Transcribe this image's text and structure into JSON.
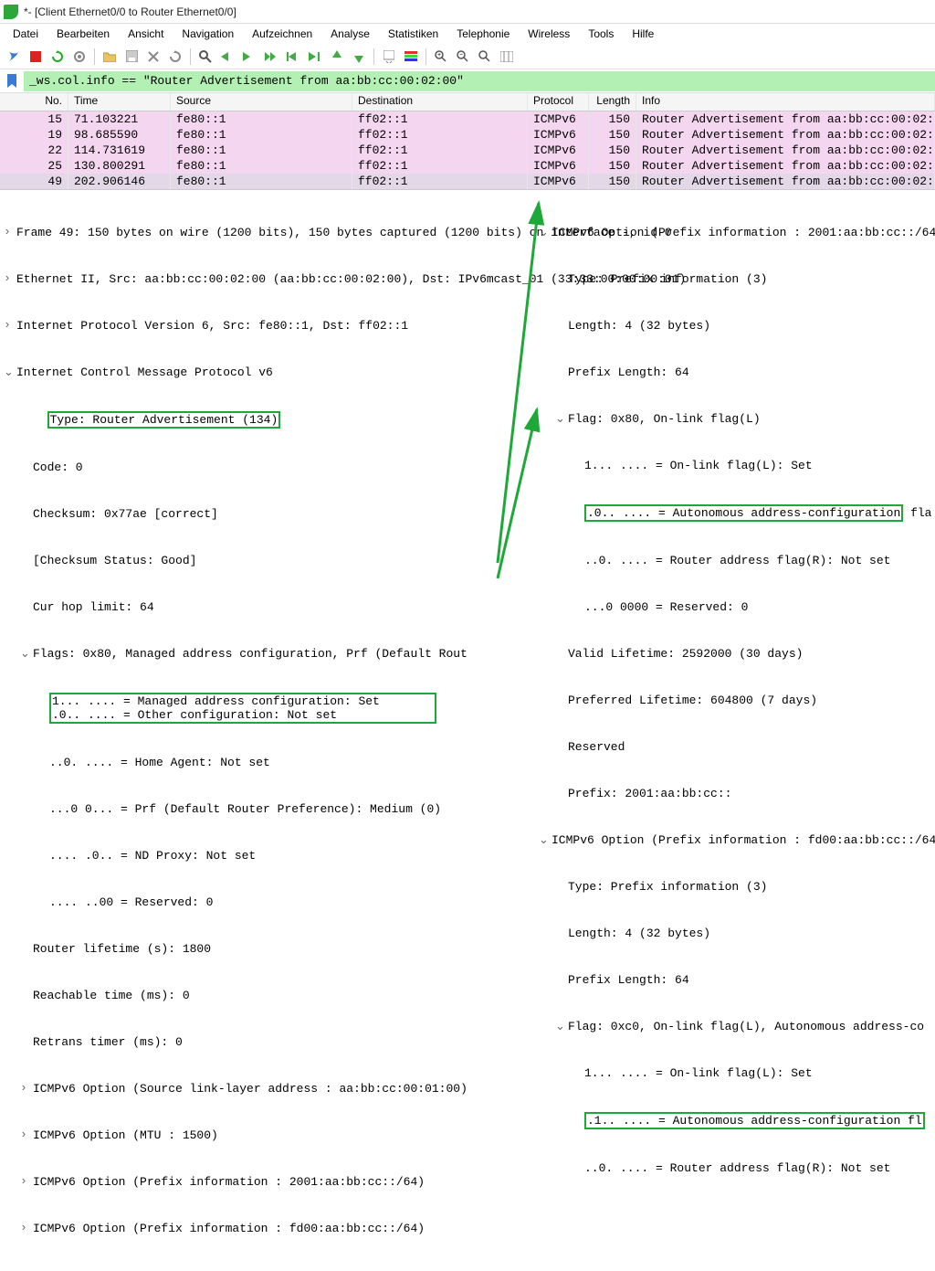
{
  "window": {
    "title": "*- [Client Ethernet0/0 to Router Ethernet0/0]"
  },
  "menu": [
    "Datei",
    "Bearbeiten",
    "Ansicht",
    "Navigation",
    "Aufzeichnen",
    "Analyse",
    "Statistiken",
    "Telephonie",
    "Wireless",
    "Tools",
    "Hilfe"
  ],
  "filter": {
    "value": "_ws.col.info == \"Router Advertisement from aa:bb:cc:00:02:00\""
  },
  "columns": [
    "No.",
    "Time",
    "Source",
    "Destination",
    "Protocol",
    "Length",
    "Info"
  ],
  "packets": [
    {
      "no": "15",
      "time": "71.103221",
      "src": "fe80::1",
      "dst": "ff02::1",
      "proto": "ICMPv6",
      "len": "150",
      "info": "Router Advertisement from aa:bb:cc:00:02:00",
      "sel": false
    },
    {
      "no": "19",
      "time": "98.685590",
      "src": "fe80::1",
      "dst": "ff02::1",
      "proto": "ICMPv6",
      "len": "150",
      "info": "Router Advertisement from aa:bb:cc:00:02:00",
      "sel": false
    },
    {
      "no": "22",
      "time": "114.731619",
      "src": "fe80::1",
      "dst": "ff02::1",
      "proto": "ICMPv6",
      "len": "150",
      "info": "Router Advertisement from aa:bb:cc:00:02:00",
      "sel": false
    },
    {
      "no": "25",
      "time": "130.800291",
      "src": "fe80::1",
      "dst": "ff02::1",
      "proto": "ICMPv6",
      "len": "150",
      "info": "Router Advertisement from aa:bb:cc:00:02:00",
      "sel": false
    },
    {
      "no": "49",
      "time": "202.906146",
      "src": "fe80::1",
      "dst": "ff02::1",
      "proto": "ICMPv6",
      "len": "150",
      "info": "Router Advertisement from aa:bb:cc:00:02:00",
      "sel": true
    }
  ],
  "left": {
    "l0": "Frame 49: 150 bytes on wire (1200 bits), 150 bytes captured (1200 bits) on interface -, id 0",
    "l1": "Ethernet II, Src: aa:bb:cc:00:02:00 (aa:bb:cc:00:02:00), Dst: IPv6mcast_01 (33:33:00:00:00:01)",
    "l2": "Internet Protocol Version 6, Src: fe80::1, Dst: ff02::1",
    "l3": "Internet Control Message Protocol v6",
    "l4": "Type: Router Advertisement (134)",
    "l5": "Code: 0",
    "l6": "Checksum: 0x77ae [correct]",
    "l7": "[Checksum Status: Good]",
    "l8": "Cur hop limit: 64",
    "l9": "Flags: 0x80, Managed address configuration, Prf (Default Rout",
    "l10": "1... .... = Managed address configuration: Set",
    "l11": ".0.. .... = Other configuration: Not set",
    "l12": "..0. .... = Home Agent: Not set",
    "l13": "...0 0... = Prf (Default Router Preference): Medium (0)",
    "l14": ".... .0.. = ND Proxy: Not set",
    "l15": ".... ..00 = Reserved: 0",
    "l16": "Router lifetime (s): 1800",
    "l17": "Reachable time (ms): 0",
    "l18": "Retrans timer (ms): 0",
    "l19": "ICMPv6 Option (Source link-layer address : aa:bb:cc:00:01:00)",
    "l20": "ICMPv6 Option (MTU : 1500)",
    "l21": "ICMPv6 Option (Prefix information : 2001:aa:bb:cc::/64)",
    "l22": "ICMPv6 Option (Prefix information : fd00:aa:bb:cc::/64)"
  },
  "right": {
    "r0": "ICMPv6 Option (Prefix information : 2001:aa:bb:cc::/64",
    "r1": "Type: Prefix information (3)",
    "r2": "Length: 4 (32 bytes)",
    "r3": "Prefix Length: 64",
    "r4": "Flag: 0x80, On-link flag(L)",
    "r5": "1... .... = On-link flag(L): Set",
    "r6": ".0.. .... = Autonomous address-configuration",
    "r6b": " fla",
    "r7": "..0. .... = Router address flag(R): Not set",
    "r8": "...0 0000 = Reserved: 0",
    "r9": "Valid Lifetime: 2592000 (30 days)",
    "r10": "Preferred Lifetime: 604800 (7 days)",
    "r11": "Reserved",
    "r12": "Prefix: 2001:aa:bb:cc::",
    "r13": "ICMPv6 Option (Prefix information : fd00:aa:bb:cc::/64",
    "r14": "Type: Prefix information (3)",
    "r15": "Length: 4 (32 bytes)",
    "r16": "Prefix Length: 64",
    "r17": "Flag: 0xc0, On-link flag(L), Autonomous address-co",
    "r18": "1... .... = On-link flag(L): Set",
    "r19": ".1.. .... = Autonomous address-configuration fl",
    "r20": "..0. .... = Router address flag(R): Not set"
  },
  "colors": {
    "highlight": "#1ea838",
    "filterbg": "#b3f0b3",
    "pink": "#f5d6f0"
  }
}
